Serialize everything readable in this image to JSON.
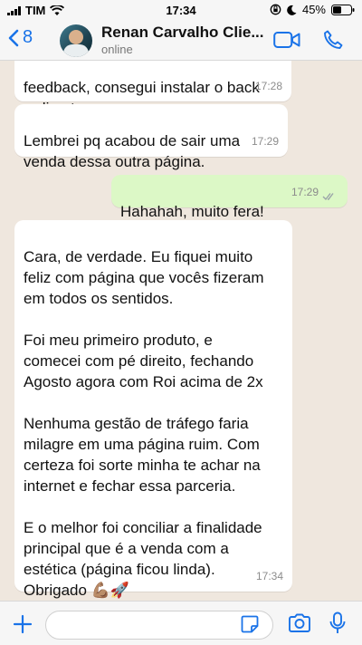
{
  "status_bar": {
    "carrier": "TIM",
    "time": "17:34",
    "battery": "45%"
  },
  "header": {
    "back_count": "8",
    "contact_name": "Renan Carvalho Clie...",
    "contact_status": "online",
    "accent_color": "#1a73e8"
  },
  "messages": [
    {
      "direction": "in",
      "text": "feedback, consegui instalar o back\nredirect",
      "time": "17:28"
    },
    {
      "direction": "in",
      "text": "Lembrei pq acabou de sair uma\nvenda dessa outra página.",
      "time": "17:29"
    },
    {
      "direction": "out",
      "text": "Hahahah, muito fera!",
      "time": "17:29",
      "read": true
    },
    {
      "direction": "in",
      "text": "Cara, de verdade. Eu fiquei muito\nfeliz com página que vocês fizeram\nem todos os sentidos.\n\nFoi meu primeiro produto, e\ncomecei com pé direito, fechando\nAgosto agora com Roi acima de 2x\n\nNenhuma gestão de tráfego faria\nmilagre em uma página ruim. Com\ncerteza foi sorte minha te achar na\ninternet e fechar essa parceria.\n\nE o melhor foi conciliar a finalidade\nprincipal que é a venda com a\nestética (página ficou linda).\nObrigado 💪🏽🚀",
      "time": "17:34"
    }
  ],
  "footer": {
    "icons": [
      "plus-icon",
      "sticker-icon",
      "camera-icon",
      "microphone-icon"
    ]
  }
}
